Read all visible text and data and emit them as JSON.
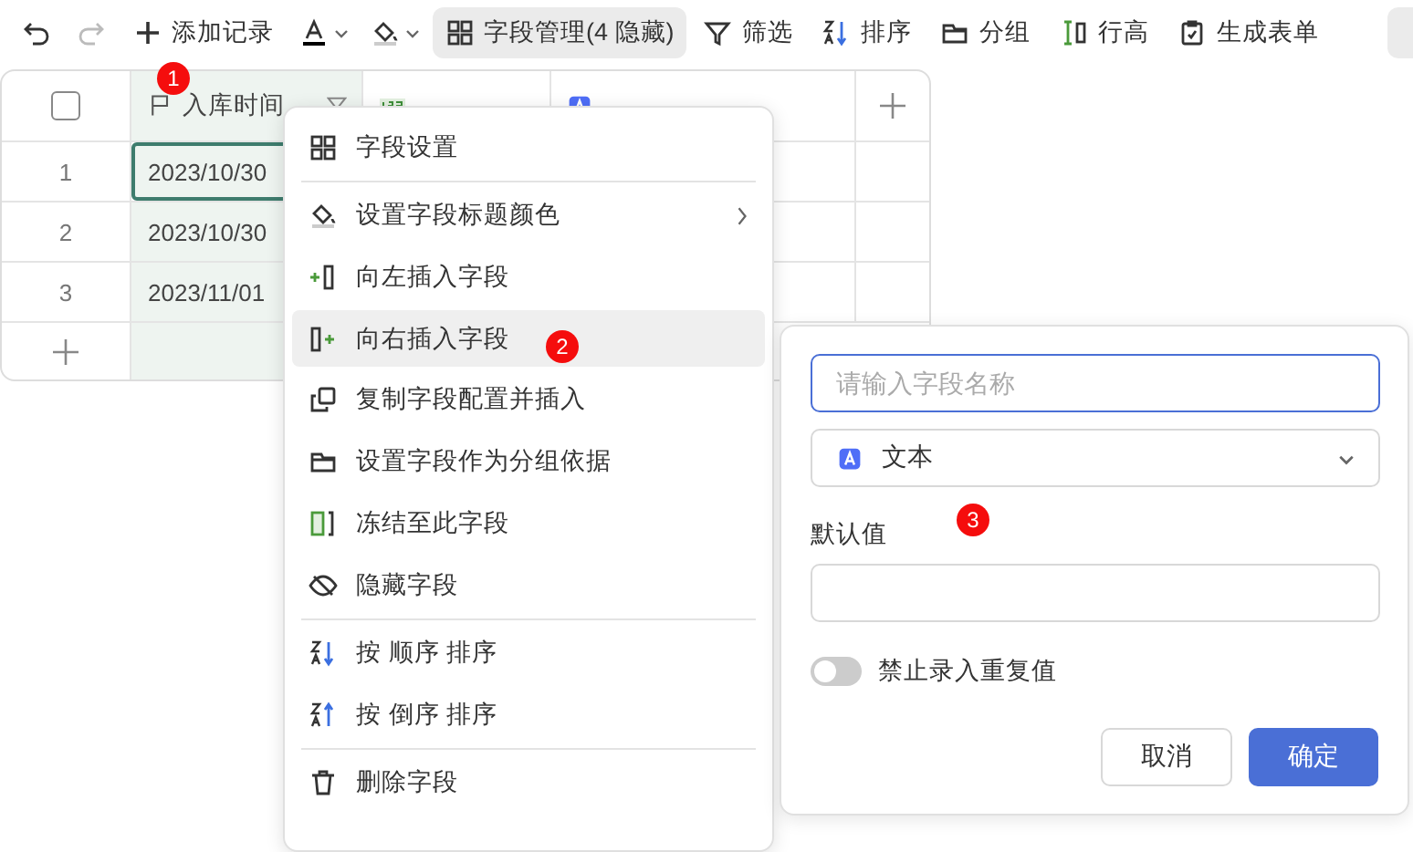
{
  "toolbar": [
    {
      "kind": "undo",
      "disabled": false
    },
    {
      "kind": "redo",
      "disabled": true
    },
    {
      "kind": "add",
      "label": "添加记录"
    },
    {
      "kind": "textcolor"
    },
    {
      "kind": "fillcolor"
    },
    {
      "kind": "fields",
      "label": "字段管理(4 隐藏)",
      "selected": true
    },
    {
      "kind": "filter",
      "label": "筛选",
      "selected": false
    },
    {
      "kind": "sort",
      "label": "排序",
      "selected": false
    },
    {
      "kind": "group",
      "label": "分组",
      "selected": false
    },
    {
      "kind": "rowheight",
      "label": "行高",
      "selected": false
    },
    {
      "kind": "form",
      "label": "生成表单",
      "selected": false
    },
    {
      "kind": "clipped"
    }
  ],
  "table": {
    "select_all": {
      "checked": false
    },
    "columns": [
      {
        "label": "入库时间",
        "selected": true,
        "filtered": true
      },
      {
        "selected": false,
        "filtered": false
      },
      {
        "selected": false,
        "filtered": false
      }
    ],
    "rows": [
      {
        "number": "1",
        "cells": [
          {
            "text": "2023/10/30",
            "selected": true
          }
        ]
      },
      {
        "number": "2",
        "cells": [
          {
            "text": "2023/10/30",
            "selected": false
          }
        ]
      },
      {
        "number": "3",
        "cells": [
          {
            "text": "2023/11/01",
            "selected": false
          }
        ]
      }
    ]
  },
  "context_menu": {
    "groups": [
      [
        {
          "label": "字段设置",
          "submenu": false,
          "selected": false
        }
      ],
      [
        {
          "label": "设置字段标题颜色",
          "submenu": true,
          "selected": false
        },
        {
          "label": "向左插入字段",
          "submenu": false,
          "selected": false
        },
        {
          "label": "向右插入字段",
          "submenu": false,
          "selected": true
        },
        {
          "label": "复制字段配置并插入",
          "submenu": false,
          "selected": false
        },
        {
          "label": "设置字段作为分组依据",
          "submenu": false,
          "selected": false
        },
        {
          "label": "冻结至此字段",
          "submenu": false,
          "selected": false
        },
        {
          "label": "隐藏字段",
          "submenu": false,
          "selected": false
        }
      ],
      [
        {
          "label": "按 顺序 排序",
          "submenu": false,
          "selected": false
        },
        {
          "label": "按 倒序 排序",
          "submenu": false,
          "selected": false
        }
      ],
      [
        {
          "label": "删除字段",
          "submenu": false,
          "selected": false
        }
      ]
    ]
  },
  "field_panel": {
    "name_field": {
      "placeholder": "请输入字段名称"
    },
    "type_select": {
      "value": "文本"
    },
    "default_label": "默认值",
    "unique_toggle": {
      "label": "禁止录入重复值",
      "on": false
    },
    "buttons": [
      {
        "kind": "secondary",
        "label": "取消"
      },
      {
        "kind": "primary",
        "label": "确定"
      }
    ]
  },
  "markers": [
    "1",
    "2",
    "3"
  ]
}
